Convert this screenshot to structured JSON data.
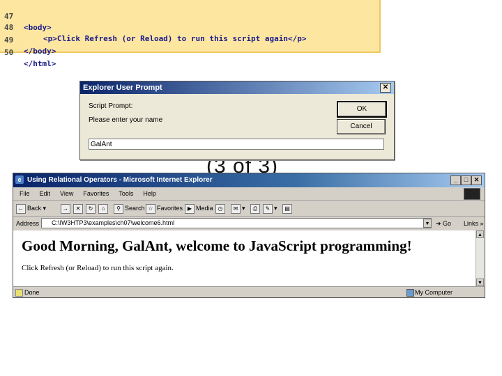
{
  "code_listing": {
    "lines": [
      {
        "num": "47",
        "text": "<body>",
        "indent": 0
      },
      {
        "num": "48",
        "text": "<p>Click Refresh (or Reload) to run this script again</p>",
        "indent": 1
      },
      {
        "num": "49",
        "text": "</body>",
        "indent": 0
      },
      {
        "num": "50",
        "text": "</html>",
        "indent": 0
      }
    ]
  },
  "subtitle": "(3 of 3)",
  "prompt_dialog": {
    "title": "Explorer User Prompt",
    "close_label": "✕",
    "script_prompt_label": "Script Prompt:",
    "message": "Please enter your name",
    "ok_label": "OK",
    "cancel_label": "Cancel",
    "input_value": "GalAnt"
  },
  "browser": {
    "title": "Using Relational Operators - Microsoft Internet Explorer",
    "menu": [
      "File",
      "Edit",
      "View",
      "Favorites",
      "Tools",
      "Help"
    ],
    "toolbar": {
      "back_label": "Back",
      "search_label": "Search",
      "favorites_label": "Favorites",
      "media_label": "Media"
    },
    "address_label": "Address",
    "address_value": "C:\\IW3HTP3\\examples\\ch07\\welcome6.html",
    "go_label": "Go",
    "links_label": "Links",
    "page": {
      "heading": "Good Morning, GalAnt, welcome to JavaScript programming!",
      "paragraph": "Click Refresh (or Reload) to run this script again."
    },
    "status": "Done",
    "zone": "My Computer"
  },
  "colors": {
    "code_bg": "#fde6a0",
    "title_bar_start": "#0a246a",
    "title_bar_end": "#a6caf0",
    "chrome": "#d4d0c8"
  }
}
